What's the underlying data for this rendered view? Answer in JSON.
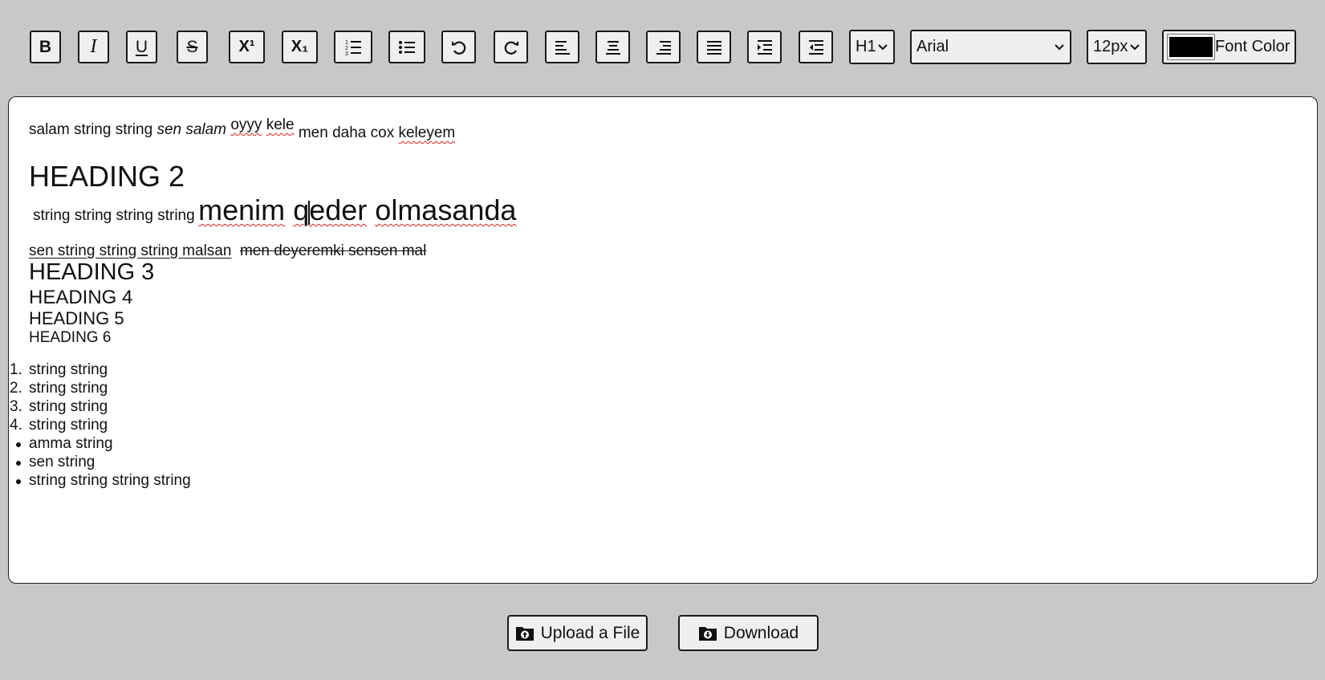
{
  "toolbar": {
    "buttons": [
      {
        "name": "bold-button",
        "label": "B"
      },
      {
        "name": "italic-button",
        "label": "I"
      },
      {
        "name": "underline-button",
        "label": "U"
      },
      {
        "name": "strikethrough-button",
        "label": "S"
      },
      {
        "name": "superscript-button",
        "label": "X¹"
      },
      {
        "name": "subscript-button",
        "label": "X₁"
      },
      {
        "name": "ordered-list-button",
        "icon": "ordered-list-icon"
      },
      {
        "name": "unordered-list-button",
        "icon": "unordered-list-icon"
      },
      {
        "name": "undo-button",
        "icon": "undo-icon"
      },
      {
        "name": "redo-button",
        "icon": "redo-icon"
      },
      {
        "name": "align-left-button",
        "icon": "align-left-icon"
      },
      {
        "name": "align-center-button",
        "icon": "align-center-icon"
      },
      {
        "name": "align-right-button",
        "icon": "align-right-icon"
      },
      {
        "name": "align-justify-button",
        "icon": "align-justify-icon"
      },
      {
        "name": "indent-button",
        "icon": "indent-icon"
      },
      {
        "name": "outdent-button",
        "icon": "outdent-icon"
      }
    ],
    "heading_select": "H1",
    "font_select": "Arial",
    "size_select": "12px",
    "font_color_label": "Font Color",
    "font_color_value": "#000000"
  },
  "editor": {
    "line1": {
      "plain1": "salam string string ",
      "italic": "sen salam",
      "raised_a": "oyyy",
      "raised_b": "kele",
      "plain2": " men daha cox ",
      "sq1": "keleyem"
    },
    "heading2": "HEADING 2",
    "line3": {
      "small": "string string string string",
      "big_a": "menim",
      "big_b1": "q",
      "big_b2": "eder",
      "big_c": "olmasanda"
    },
    "line4": {
      "u1": "sen ",
      "u2": "string ",
      "u3": "string ",
      "u4": "string ",
      "u5": "malsan",
      "strike": "men deyeremki sensen mal"
    },
    "heading3": "HEADING 3",
    "heading4": "HEADING 4",
    "heading5": "HEADING 5",
    "heading6": "HEADING 6",
    "ordered": [
      {
        "num": "1.",
        "text": "string string"
      },
      {
        "num": "2.",
        "text": "string string"
      },
      {
        "num": "3.",
        "text": "string string"
      },
      {
        "num": "4.",
        "text": "string string"
      }
    ],
    "bullets": [
      "amma string",
      "sen string",
      "string string string string"
    ]
  },
  "footer": {
    "upload_label": "Upload a File",
    "download_label": "Download",
    "upload_icon": "folder-upload-icon",
    "download_icon": "folder-download-icon"
  }
}
